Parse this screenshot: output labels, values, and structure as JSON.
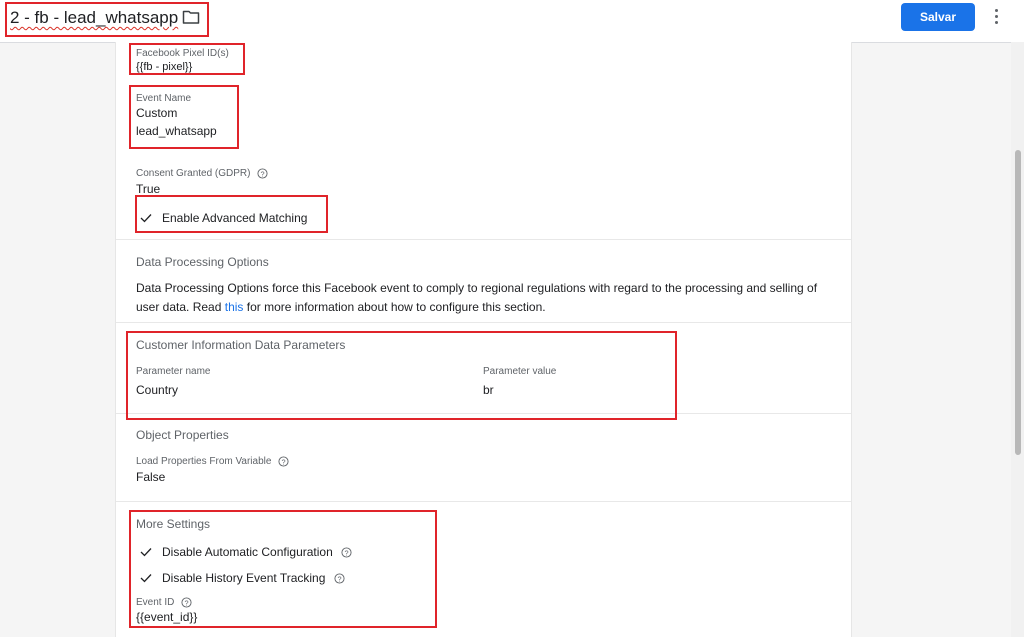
{
  "header": {
    "title": "2 - fb - lead_whatsapp",
    "save_label": "Salvar"
  },
  "fields": {
    "pixel_label": "Facebook Pixel ID(s)",
    "pixel_value": "{{fb - pixel}}",
    "event_name_label": "Event Name",
    "event_type": "Custom",
    "event_name_value": "lead_whatsapp",
    "consent_label": "Consent Granted (GDPR)",
    "consent_value": "True",
    "advanced_matching": "Enable Advanced Matching"
  },
  "data_processing": {
    "title": "Data Processing Options",
    "text_before": "Data Processing Options force this Facebook event to comply to regional regulations with regard to the processing and selling of user data. Read ",
    "link": "this",
    "text_after": " for more information about how to configure this section."
  },
  "customer_info": {
    "title": "Customer Information Data Parameters",
    "col_name": "Parameter name",
    "col_value": "Parameter value",
    "row_name": "Country",
    "row_value": "br"
  },
  "object_props": {
    "title": "Object Properties",
    "load_label": "Load Properties From Variable",
    "load_value": "False"
  },
  "more_settings": {
    "title": "More Settings",
    "disable_auto_config": "Disable Automatic Configuration",
    "disable_history": "Disable History Event Tracking",
    "event_id_label": "Event ID",
    "event_id_value": "{{event_id}}"
  },
  "colors": {
    "accent": "#1a73e8",
    "highlight": "#e0242a"
  }
}
